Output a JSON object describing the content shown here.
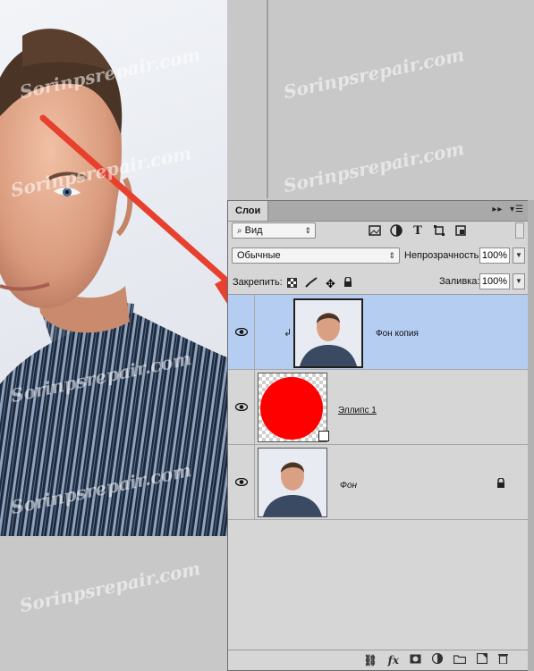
{
  "watermark": "Sorinpsrepair.com",
  "layers_panel": {
    "tab_label": "Слои",
    "filter_kind": "Вид",
    "blend_mode": "Обычные",
    "opacity_label": "Непрозрачность:",
    "opacity_value": "100%",
    "lock_label": "Закрепить:",
    "fill_label": "Заливка:",
    "fill_value": "100%",
    "layers": [
      {
        "name": "Фон копия",
        "selected": true,
        "thumbnail": "portrait-photo",
        "clipped": true
      },
      {
        "name": "Эллипс 1",
        "selected": false,
        "thumbnail": "red-ellipse-on-transparent"
      },
      {
        "name": "Фон",
        "selected": false,
        "thumbnail": "portrait-photo",
        "locked": true
      }
    ]
  },
  "colors": {
    "ellipse": "#ff0000",
    "selected_layer": "#b6cdf2",
    "arrow": "#e8402f",
    "panel": "#d6d6d6"
  },
  "icons": [
    "search-icon",
    "image-filter-icon",
    "adjustment-filter-icon",
    "type-filter-icon",
    "shape-filter-icon",
    "smart-object-filter-icon",
    "lock-transparent-icon",
    "lock-paint-icon",
    "lock-position-icon",
    "lock-all-icon",
    "eye-icon",
    "link-icon",
    "fx-icon",
    "mask-icon",
    "adjustment-layer-icon",
    "group-folder-icon",
    "new-layer-icon",
    "trash-icon"
  ]
}
